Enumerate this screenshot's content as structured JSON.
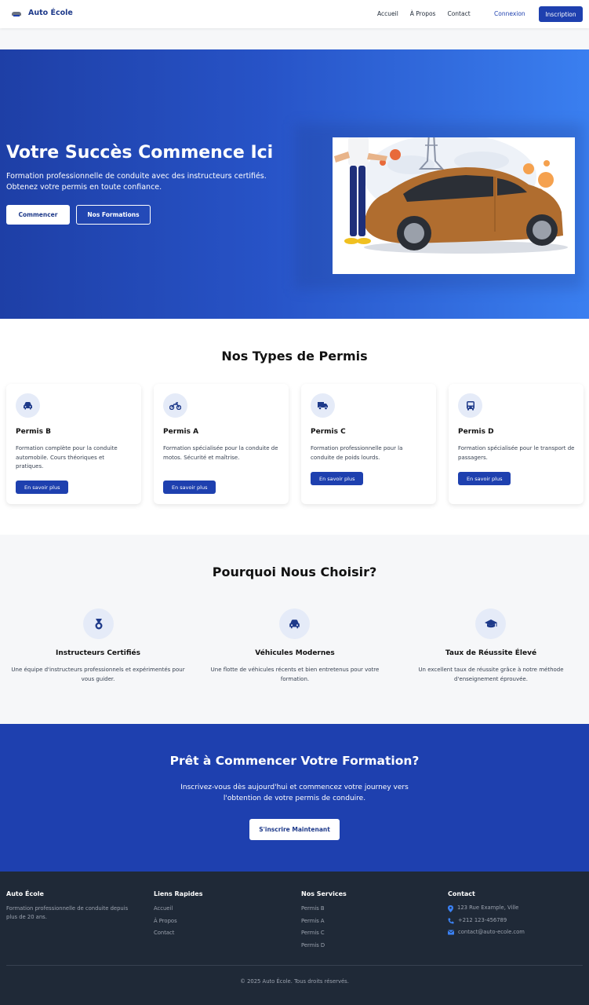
{
  "brand": {
    "name": "Auto École"
  },
  "nav": {
    "links": [
      "Accueil",
      "À Propos",
      "Contact"
    ],
    "login": "Connexion",
    "signup": "Inscription"
  },
  "hero": {
    "title": "Votre Succès Commence Ici",
    "subtitle": "Formation professionnelle de conduite avec des instructeurs certifiés. Obtenez votre permis en toute confiance.",
    "primary_button": "Commencer",
    "secondary_button": "Nos Formations",
    "image_icon": "driving-instructor-car-paris-illustration"
  },
  "permis": {
    "title": "Nos Types de Permis",
    "cards": [
      {
        "icon": "car-icon",
        "title": "Permis B",
        "description": "Formation complète pour la conduite automobile. Cours théoriques et pratiques.",
        "button": "En savoir plus"
      },
      {
        "icon": "motorcycle-icon",
        "title": "Permis A",
        "description": "Formation spécialisée pour la conduite de motos. Sécurité et maîtrise.",
        "button": "En savoir plus"
      },
      {
        "icon": "truck-icon",
        "title": "Permis C",
        "description": "Formation professionnelle pour la conduite de poids lourds.",
        "button": "En savoir plus"
      },
      {
        "icon": "bus-icon",
        "title": "Permis D",
        "description": "Formation spécialisée pour le transport de passagers.",
        "button": "En savoir plus"
      }
    ]
  },
  "why": {
    "title": "Pourquoi Nous Choisir?",
    "items": [
      {
        "icon": "medal-icon",
        "title": "Instructeurs Certifiés",
        "description": "Une équipe d'instructeurs professionnels et expérimentés pour vous guider."
      },
      {
        "icon": "car-icon",
        "title": "Véhicules Modernes",
        "description": "Une flotte de véhicules récents et bien entretenus pour votre formation."
      },
      {
        "icon": "graduation-cap-icon",
        "title": "Taux de Réussite Élevé",
        "description": "Un excellent taux de réussite grâce à notre méthode d'enseignement éprouvée."
      }
    ]
  },
  "cta": {
    "title": "Prêt à Commencer Votre Formation?",
    "subtitle": "Inscrivez-vous dès aujourd'hui et commencez votre journey vers l'obtention de votre permis de conduire.",
    "button": "S'inscrire Maintenant"
  },
  "footer": {
    "about": {
      "title": "Auto École",
      "text": "Formation professionnelle de conduite depuis plus de 20 ans."
    },
    "links": {
      "title": "Liens Rapides",
      "items": [
        "Accueil",
        "À Propos",
        "Contact"
      ]
    },
    "services": {
      "title": "Nos Services",
      "items": [
        "Permis B",
        "Permis A",
        "Permis C",
        "Permis D"
      ]
    },
    "contact": {
      "title": "Contact",
      "address": "123 Rue Example, Ville",
      "phone": "+212 123-456789",
      "email": "contact@auto-ecole.com"
    },
    "copyright": "© 2025 Auto École. Tous droits réservés."
  },
  "colors": {
    "primary": "#1e40af",
    "footer_bg": "#1f2937",
    "icon_bg": "#e5ebf8"
  }
}
